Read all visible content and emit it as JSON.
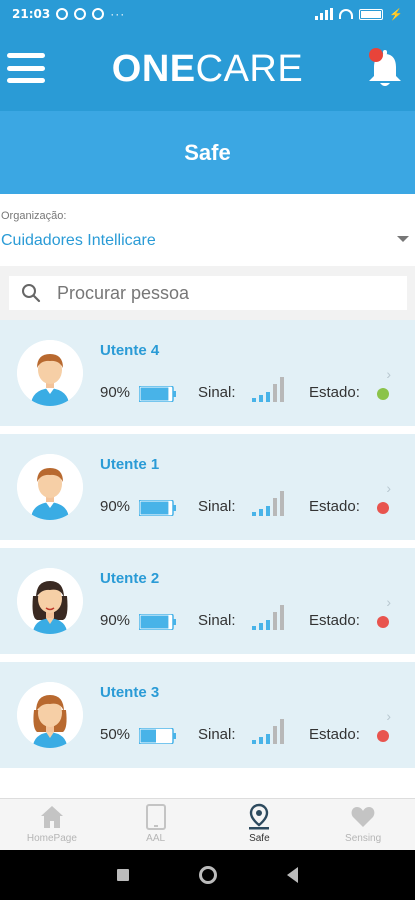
{
  "status_bar": {
    "time": "21:03",
    "dots": "···"
  },
  "app": {
    "brand_bold": "ONE",
    "brand_light": "CARE",
    "menu_icon": "hamburger-icon",
    "bell_icon": "bell-icon"
  },
  "page": {
    "title": "Safe"
  },
  "organization": {
    "label": "Organização:",
    "value": "Cuidadores Intellicare"
  },
  "search": {
    "placeholder": "Procurar pessoa",
    "value": ""
  },
  "labels": {
    "sinal": "Sinal:",
    "estado": "Estado:"
  },
  "colors": {
    "primary": "#2a9bd6",
    "header": "#3ba7e3",
    "card_bg": "#e2f0f6",
    "ok": "#8bc34a",
    "alert": "#e8544e",
    "battery": "#48b3e8"
  },
  "people": [
    {
      "name": "Utente 4",
      "battery_label": "90%",
      "battery_level": 0.9,
      "signal_level": 4,
      "status": "ok",
      "avatar": "male-avatar-icon"
    },
    {
      "name": "Utente 1",
      "battery_label": "90%",
      "battery_level": 0.9,
      "signal_level": 4,
      "status": "alert",
      "avatar": "male-avatar-icon"
    },
    {
      "name": "Utente 2",
      "battery_label": "90%",
      "battery_level": 0.9,
      "signal_level": 4,
      "status": "alert",
      "avatar": "female-dark-hair-avatar-icon"
    },
    {
      "name": "Utente 3",
      "battery_label": "50%",
      "battery_level": 0.5,
      "signal_level": 4,
      "status": "alert",
      "avatar": "female-light-hair-avatar-icon"
    }
  ],
  "bottom_nav": [
    {
      "label": "HomePage",
      "icon": "home-icon",
      "active": false
    },
    {
      "label": "AAL",
      "icon": "tablet-icon",
      "active": false
    },
    {
      "label": "Safe",
      "icon": "map-pin-icon",
      "active": true
    },
    {
      "label": "Sensing",
      "icon": "heart-icon",
      "active": false
    }
  ]
}
